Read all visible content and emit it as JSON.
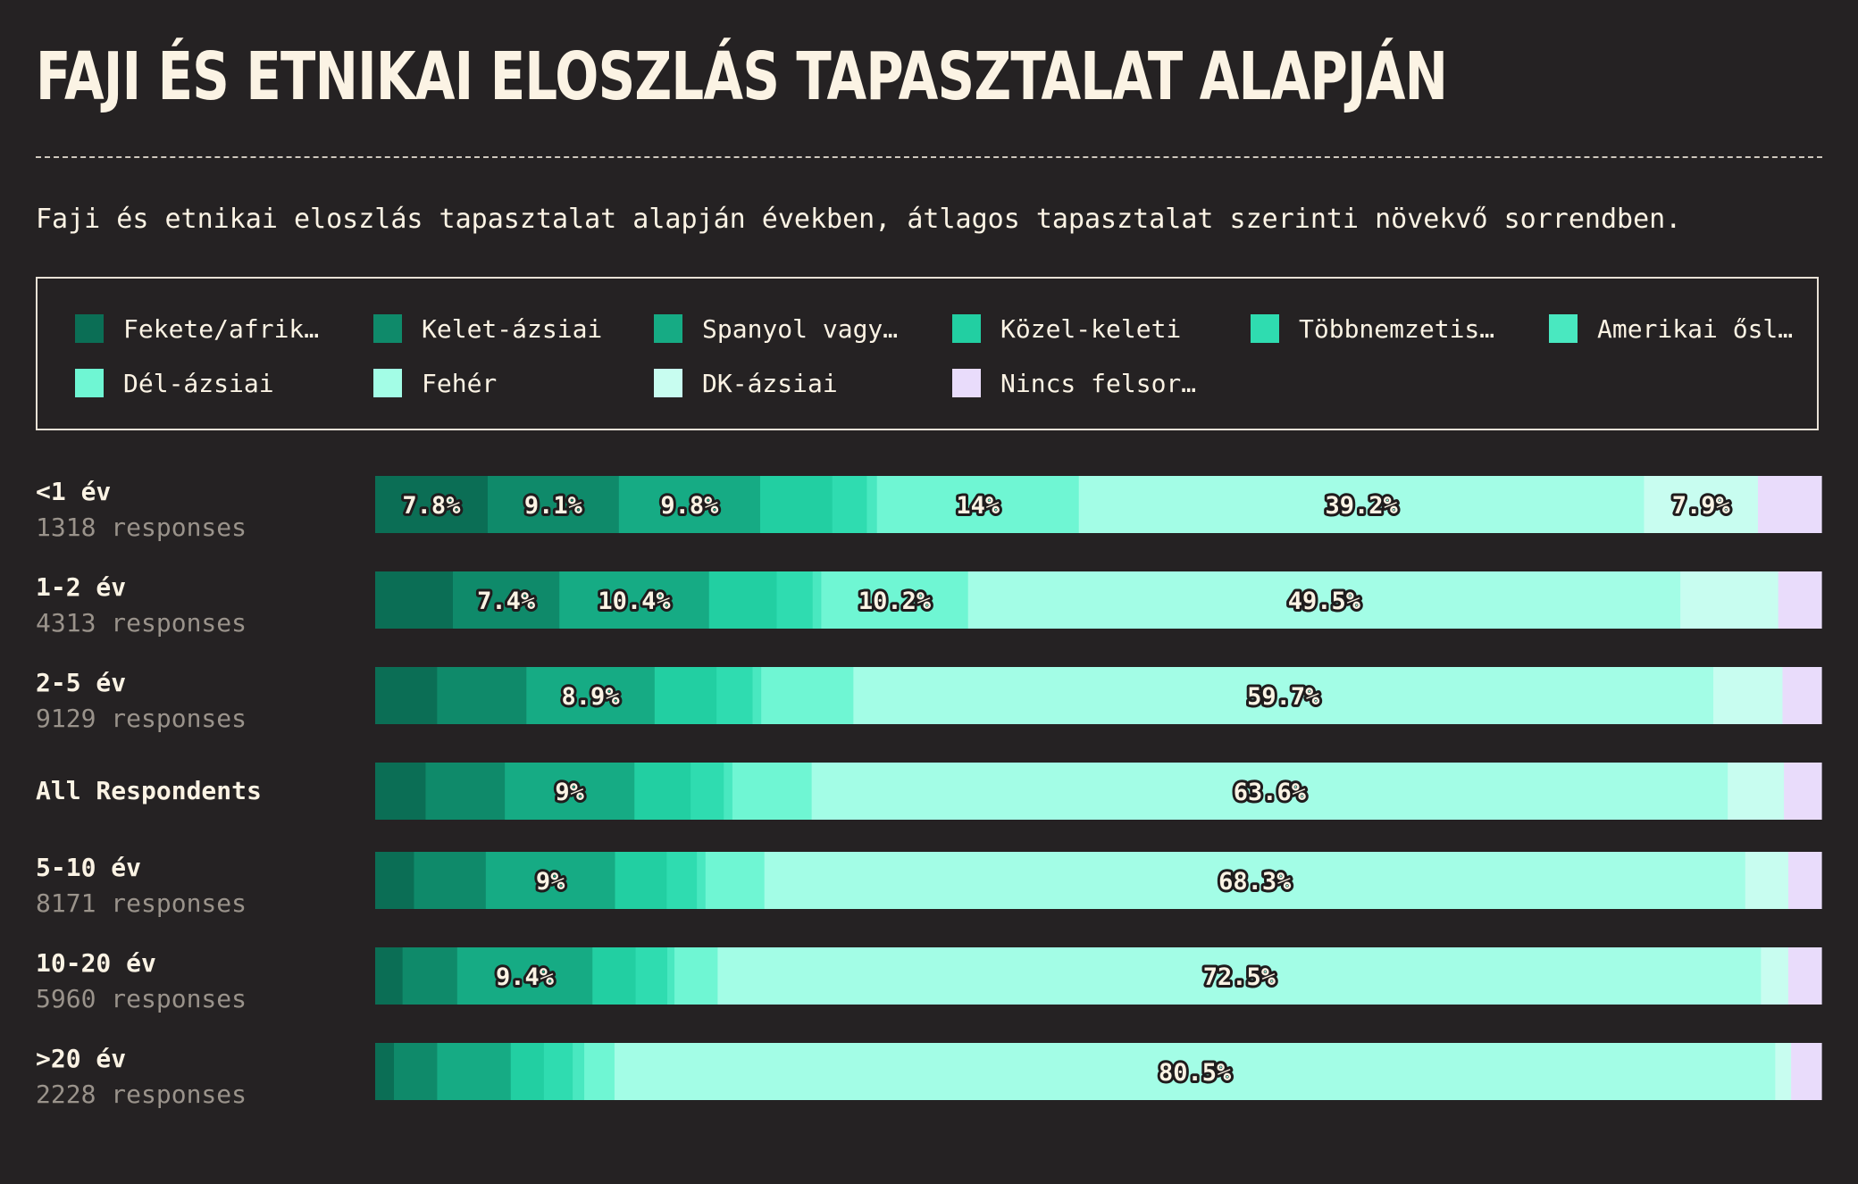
{
  "title": "FAJI ÉS ETNIKAI ELOSZLÁS TAPASZTALAT ALAPJÁN",
  "subtitle": "Faji és etnikai eloszlás tapasztalat alapján években, átlagos tapasztalat szerinti növekvő sorrendben.",
  "colors": {
    "background": "#252223",
    "text": "#fbf3e4",
    "muted_text": "#9a938b"
  },
  "chart_data": {
    "type": "bar",
    "orientation": "horizontal",
    "stacked": true,
    "normalized": true,
    "xlim": [
      0,
      100
    ],
    "unit": "%",
    "legend_position": "top",
    "series": [
      {
        "name": "Fekete/afrik…",
        "color": "#0b6e55",
        "values": [
          7.8,
          5.4,
          4.3,
          3.5,
          2.7,
          1.9,
          1.3
        ]
      },
      {
        "name": "Kelet-ázsiai",
        "color": "#0f8a6a",
        "values": [
          9.1,
          7.4,
          6.2,
          5.5,
          5.0,
          3.8,
          3.0
        ]
      },
      {
        "name": "Spanyol vagy…",
        "color": "#16ab84",
        "values": [
          9.8,
          10.4,
          8.9,
          9.0,
          9.0,
          9.4,
          5.1
        ]
      },
      {
        "name": "Közel-keleti",
        "color": "#22cfa2",
        "values": [
          5.0,
          4.7,
          4.3,
          3.9,
          3.6,
          3.0,
          2.3
        ]
      },
      {
        "name": "Többnemzetis…",
        "color": "#2fdcb0",
        "values": [
          2.4,
          2.5,
          2.5,
          2.3,
          2.1,
          2.2,
          2.0
        ]
      },
      {
        "name": "Amerikai ősl…",
        "color": "#49e8c0",
        "values": [
          0.7,
          0.6,
          0.6,
          0.6,
          0.6,
          0.5,
          0.8
        ]
      },
      {
        "name": "Dél-ázsiai",
        "color": "#6ff6d3",
        "values": [
          14.0,
          10.2,
          6.4,
          5.5,
          4.1,
          3.0,
          2.1
        ]
      },
      {
        "name": "Fehér",
        "color": "#a3fde6",
        "values": [
          39.2,
          49.5,
          59.7,
          63.6,
          68.3,
          72.5,
          80.5
        ]
      },
      {
        "name": "DK-ázsiai",
        "color": "#c8fdf0",
        "values": [
          7.9,
          6.8,
          4.8,
          3.9,
          3.0,
          1.9,
          1.1
        ]
      },
      {
        "name": "Nincs felsor…",
        "color": "#e9dcfb",
        "values": [
          4.4,
          3.0,
          2.7,
          2.6,
          2.3,
          2.3,
          2.1
        ]
      }
    ],
    "rows": [
      {
        "label": "<1 év",
        "responses": "1318 responses"
      },
      {
        "label": "1-2 év",
        "responses": "4313 responses"
      },
      {
        "label": "2-5 év",
        "responses": "9129 responses"
      },
      {
        "label": "All Respondents",
        "responses": ""
      },
      {
        "label": "5-10 év",
        "responses": "8171 responses"
      },
      {
        "label": "10-20 év",
        "responses": "5960 responses"
      },
      {
        "label": ">20 év",
        "responses": "2228 responses"
      }
    ],
    "data_labels": [
      [
        "7.8%",
        "9.1%",
        "9.8%",
        "",
        "",
        "",
        "14%",
        "39.2%",
        "7.9%",
        ""
      ],
      [
        "",
        "7.4%",
        "10.4%",
        "",
        "",
        "",
        "10.2%",
        "49.5%",
        "",
        ""
      ],
      [
        "",
        "",
        "8.9%",
        "",
        "",
        "",
        "",
        "59.7%",
        "",
        ""
      ],
      [
        "",
        "",
        "9%",
        "",
        "",
        "",
        "",
        "63.6%",
        "",
        ""
      ],
      [
        "",
        "",
        "9%",
        "",
        "",
        "",
        "",
        "68.3%",
        "",
        ""
      ],
      [
        "",
        "",
        "9.4%",
        "",
        "",
        "",
        "",
        "72.5%",
        "",
        ""
      ],
      [
        "",
        "",
        "",
        "",
        "",
        "",
        "",
        "80.5%",
        "",
        ""
      ]
    ]
  }
}
